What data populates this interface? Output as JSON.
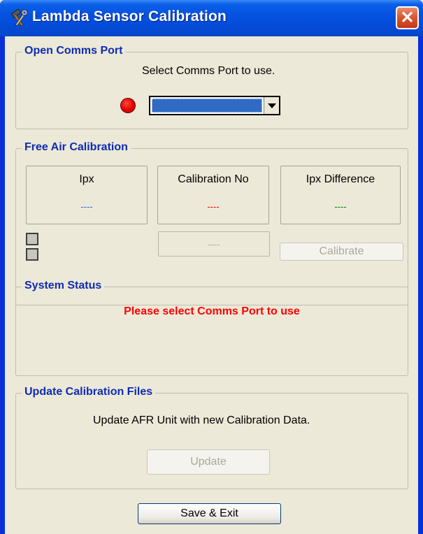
{
  "window": {
    "title": "Lambda Sensor Calibration",
    "close_glyph": "✕",
    "title_icon": "tools-icon"
  },
  "open_comms": {
    "legend": "Open Comms Port",
    "prompt": "Select Comms Port to use.",
    "status_led_color": "#e00000",
    "port_value": ""
  },
  "free_air": {
    "legend": "Free Air Calibration",
    "ipx": {
      "title": "Ipx",
      "value": "----",
      "color": "#3366cc"
    },
    "cal_no": {
      "title": "Calibration No",
      "value": "----",
      "color": "#ff0000"
    },
    "ipx_diff": {
      "title": "Ipx Difference",
      "value": "----",
      "color": "#008000"
    },
    "small_readout": "----",
    "calibrate_label": "Calibrate"
  },
  "system_status": {
    "legend": "System Status",
    "message": "Please select Comms Port to use",
    "message_color": "#ff0000"
  },
  "update_files": {
    "legend": "Update Calibration Files",
    "prompt": "Update AFR Unit with new Calibration Data.",
    "update_label": "Update"
  },
  "footer": {
    "save_exit_label": "Save & Exit"
  }
}
